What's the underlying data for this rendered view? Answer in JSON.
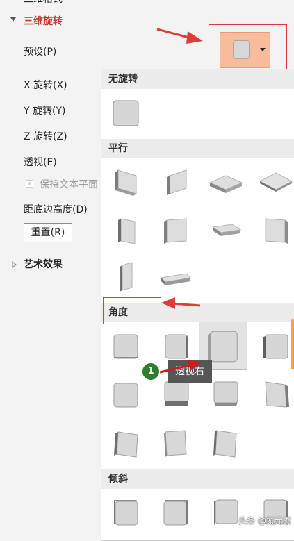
{
  "panel": {
    "prev_section_partial": "三维格式",
    "section_title": "三维旋转",
    "preset_label": "预设(P)",
    "x_rotation_label": "X 旋转(X)",
    "y_rotation_label": "Y 旋转(Y)",
    "z_rotation_label": "Z 旋转(Z)",
    "perspective_label": "透视(E)",
    "keep_text_flat_label": "保持文本平面",
    "distance_label": "距底边高度(D)",
    "reset_button": "重置(R)",
    "art_effects_label": "艺术效果"
  },
  "gallery": {
    "categories": {
      "no_rotation": "无旋转",
      "parallel": "平行",
      "perspective": "角度",
      "oblique": "倾斜"
    }
  },
  "tooltip": {
    "text": "透视右"
  },
  "badge": {
    "number": "1"
  },
  "watermark": "头条 @氮元素",
  "colors": {
    "accent_red": "#e23a3a",
    "preset_fill": "#f8bb9c",
    "badge_green": "#2e7d2e",
    "section_red": "#c0392b"
  }
}
